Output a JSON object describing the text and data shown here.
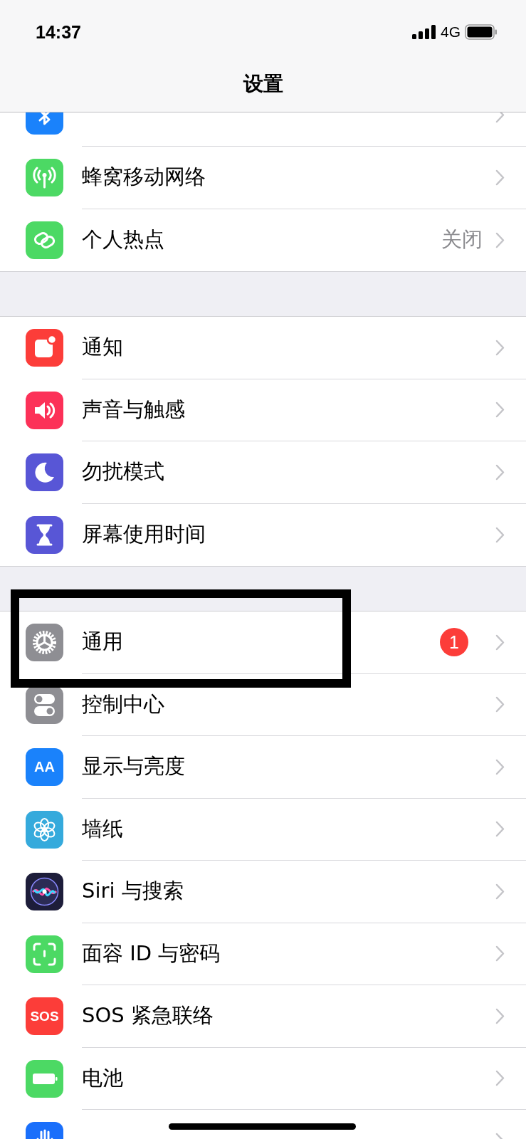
{
  "status_bar": {
    "time": "14:37",
    "network": "4G"
  },
  "nav_bar": {
    "title": "设置"
  },
  "groups": [
    {
      "items": [
        {
          "kind": "bluetooth",
          "highlighted": false
        },
        {
          "kind": "cellular",
          "label": "蜂窝移动网络",
          "highlighted": false
        },
        {
          "kind": "hotspot",
          "label": "个人热点",
          "value": "关闭",
          "highlighted": false
        }
      ]
    },
    {
      "items": [
        {
          "kind": "notifications",
          "label": "通知",
          "highlighted": false
        },
        {
          "kind": "sounds",
          "label": "声音与触感",
          "highlighted": false
        },
        {
          "kind": "dnd",
          "label": "勿扰模式",
          "highlighted": false
        },
        {
          "kind": "screentime",
          "label": "屏幕使用时间",
          "highlighted": false
        }
      ]
    },
    {
      "items": [
        {
          "kind": "general",
          "label": "通用",
          "badge": "1",
          "highlighted": true
        },
        {
          "kind": "control",
          "label": "控制中心",
          "highlighted": false
        },
        {
          "kind": "display",
          "label": "显示与亮度",
          "icon_text": "AA",
          "highlighted": false
        },
        {
          "kind": "wallpaper",
          "label": "墙纸",
          "highlighted": false
        },
        {
          "kind": "siri",
          "label": "Siri 与搜索",
          "highlighted": false
        },
        {
          "kind": "faceid",
          "label": "面容 ID 与密码",
          "highlighted": false
        },
        {
          "kind": "sos",
          "label": "SOS 紧急联络",
          "icon_text": "SOS",
          "highlighted": false
        },
        {
          "kind": "battery",
          "label": "电池",
          "highlighted": false
        },
        {
          "kind": "privacy",
          "highlighted": false
        }
      ]
    }
  ]
}
